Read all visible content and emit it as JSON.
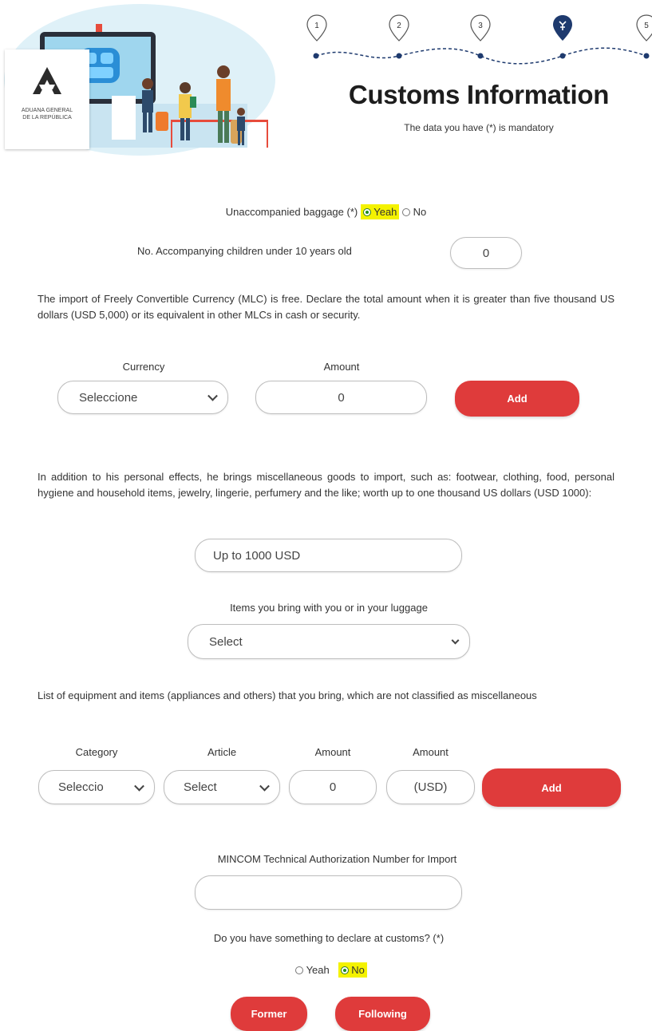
{
  "brand": {
    "logo_line1": "ADUANA GENERAL",
    "logo_line2": "DE LA REPÚBLICA"
  },
  "steps": [
    {
      "label": "1",
      "state": "done"
    },
    {
      "label": "2",
      "state": "done"
    },
    {
      "label": "3",
      "state": "done"
    },
    {
      "label": "",
      "state": "current"
    },
    {
      "label": "5",
      "state": "pending"
    }
  ],
  "header": {
    "title": "Customs Information",
    "subtitle": "The data you have (*) is mandatory"
  },
  "baggage": {
    "label": "Unaccompanied baggage (*)",
    "option_yes": "Yeah",
    "option_no": "No",
    "selected": "Yeah"
  },
  "children": {
    "label": "No. Accompanying children under 10 years old",
    "value": "0"
  },
  "currency_section": {
    "text": "The import of Freely Convertible Currency (MLC) is free. Declare the total amount when it is greater than five thousand US dollars (USD 5,000) or its equivalent in other MLCs in cash or security.",
    "currency_label": "Currency",
    "currency_value": "Seleccione",
    "amount_label": "Amount",
    "amount_value": "0",
    "add_label": "Add"
  },
  "misc_section": {
    "text": "In addition to his personal effects, he brings miscellaneous goods to import, such as: footwear, clothing, food, personal hygiene and household items, jewelry, lingerie, perfumery and the like; worth up to one thousand US dollars (USD 1000):",
    "value_field": "Up to 1000 USD",
    "items_label": "Items you bring with you or in your luggage",
    "items_value": "Select"
  },
  "equipment_section": {
    "text": "List of equipment and items (appliances and others) that you bring, which are not classified as miscellaneous",
    "category_label": "Category",
    "category_value": "Seleccio",
    "article_label": "Article",
    "article_value": "Select",
    "amount_label": "Amount",
    "amount_value": "0",
    "usd_label": "Amount",
    "usd_value": "(USD)",
    "add_label": "Add"
  },
  "mincom": {
    "label": "MINCOM Technical Authorization Number for Import",
    "value": ""
  },
  "declare": {
    "label": "Do you have something to declare at customs? (*)",
    "option_yes": "Yeah",
    "option_no": "No",
    "selected": "No"
  },
  "nav": {
    "former": "Former",
    "following": "Following"
  },
  "colors": {
    "accent_red": "#df3b3b",
    "highlight": "#f4f200",
    "step_blue": "#1e3a6e"
  }
}
